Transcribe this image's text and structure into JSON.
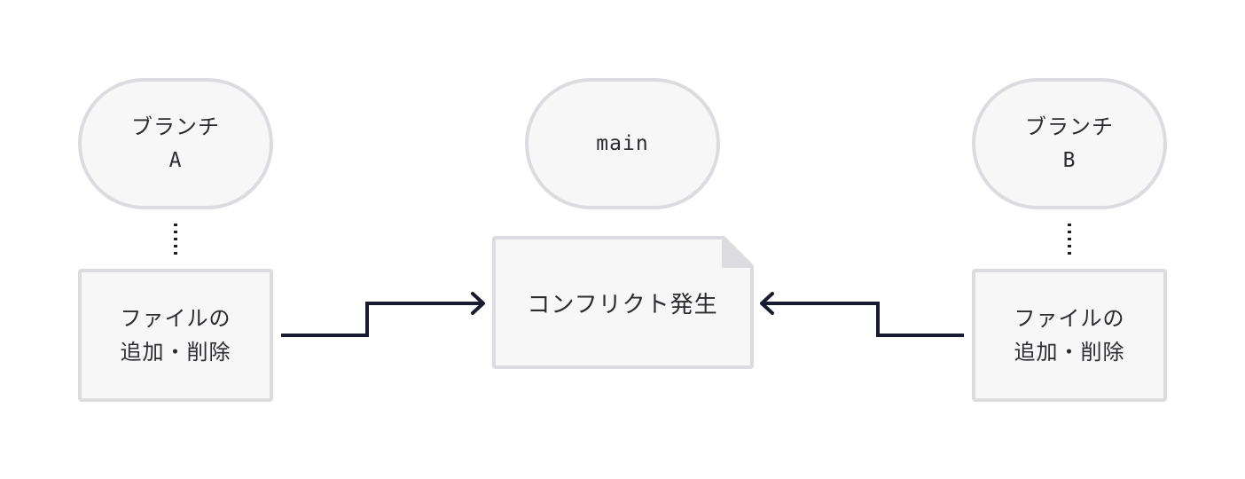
{
  "nodes": {
    "branch_a": {
      "line1": "ブランチ",
      "line2": "A"
    },
    "main": {
      "label": "main"
    },
    "branch_b": {
      "line1": "ブランチ",
      "line2": "B"
    },
    "action_a": {
      "line1": "ファイルの",
      "line2": "追加・削除"
    },
    "conflict": {
      "label": "コンフリクト発生"
    },
    "action_b": {
      "line1": "ファイルの",
      "line2": "追加・削除"
    }
  },
  "colors": {
    "node_fill": "#f7f7f7",
    "node_border": "#dcdbe0",
    "edge": "#1a1b2e",
    "text": "#2b2b30"
  }
}
